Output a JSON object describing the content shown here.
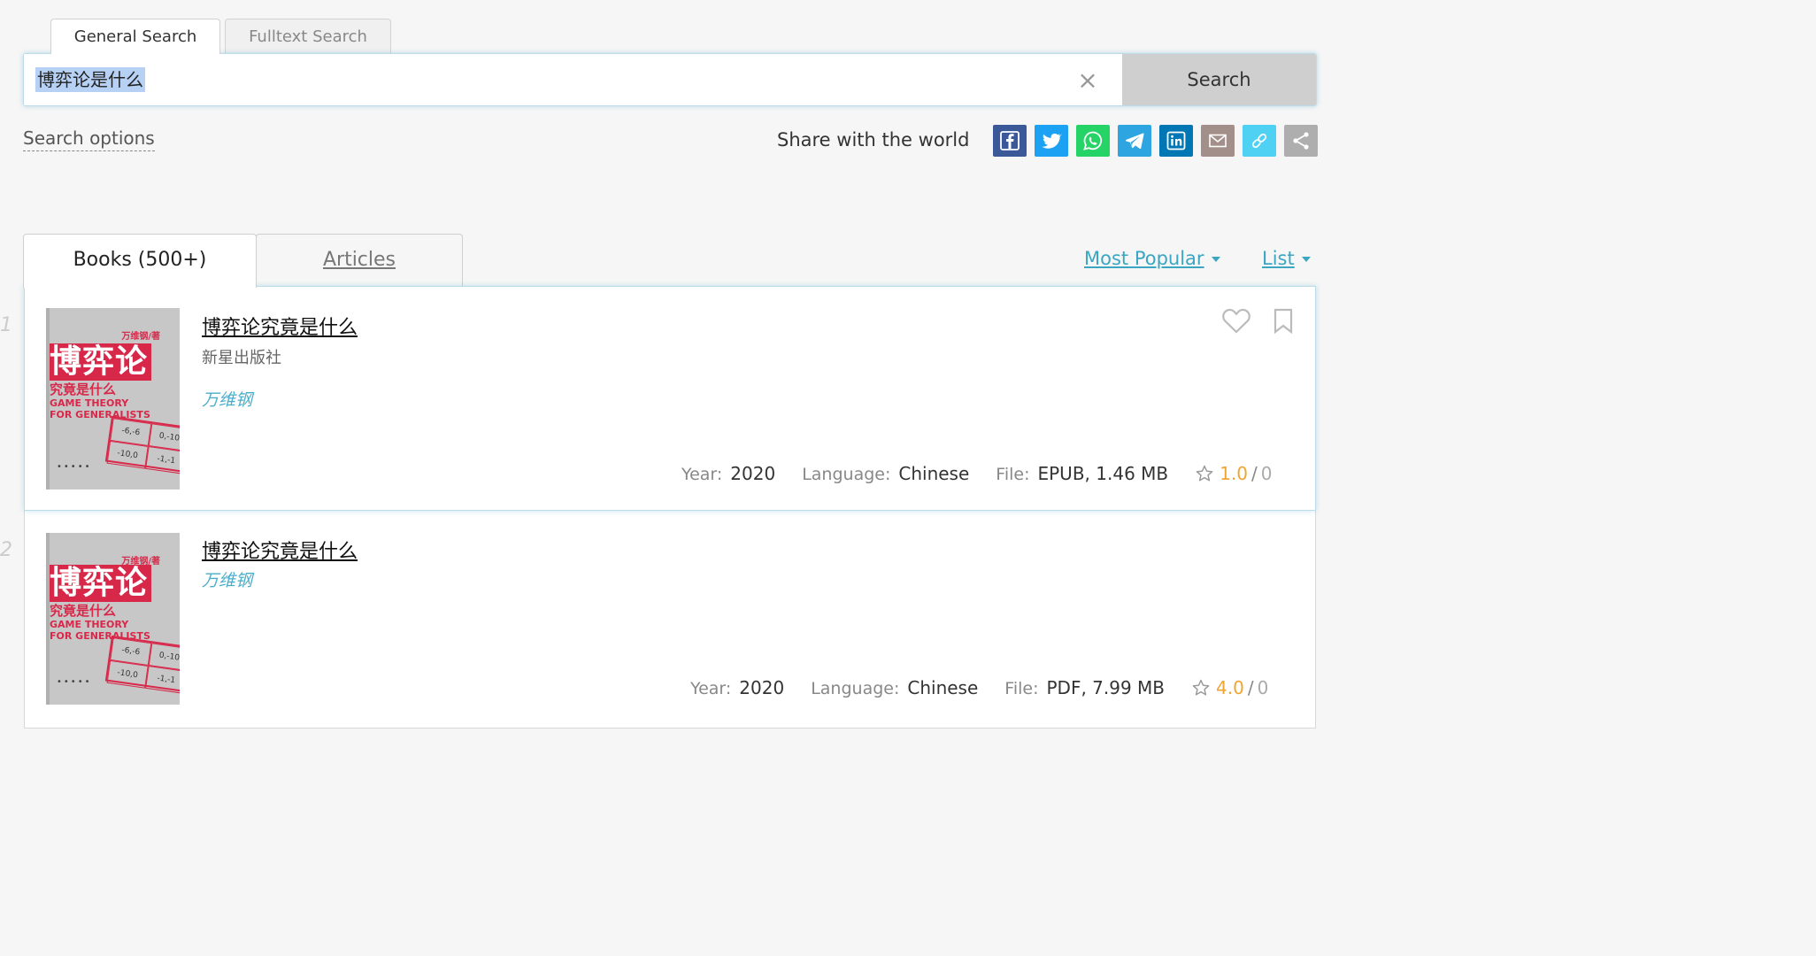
{
  "search_tabs": {
    "general": "General Search",
    "fulltext": "Fulltext Search"
  },
  "search": {
    "query": "博弈论是什么",
    "clear_icon": "close-icon",
    "button_label": "Search"
  },
  "options_link": "Search options",
  "share": {
    "label": "Share with the world",
    "icons": [
      {
        "name": "facebook-icon",
        "color": "#3b5998"
      },
      {
        "name": "twitter-icon",
        "color": "#1da1f2"
      },
      {
        "name": "whatsapp-icon",
        "color": "#25d366"
      },
      {
        "name": "telegram-icon",
        "color": "#2ca5e0"
      },
      {
        "name": "linkedin-icon",
        "color": "#0077b5"
      },
      {
        "name": "email-icon",
        "color": "#a38f8a"
      },
      {
        "name": "link-icon",
        "color": "#4fd1f4"
      },
      {
        "name": "share-icon",
        "color": "#aeaeae"
      }
    ]
  },
  "result_tabs": {
    "books": "Books (500+)",
    "articles": "Articles"
  },
  "sort": {
    "order": "Most Popular",
    "view": "List"
  },
  "results": [
    {
      "index": "1",
      "title": "博弈论究竟是什么",
      "publisher": "新星出版社",
      "author": "万维钢",
      "year_label": "Year:",
      "year": "2020",
      "language_label": "Language:",
      "language": "Chinese",
      "file_label": "File:",
      "file": "EPUB, 1.46 MB",
      "rating": "1.0",
      "votes": "0",
      "cover": {
        "author": "万维钢/著",
        "title": "博弈论",
        "subtitle": "究竟是什么",
        "english": "GAME THEORY\nFOR GENERALISTS",
        "matrix": [
          "-6,-6",
          "0,-10",
          "-10,0",
          "-1,-1"
        ]
      }
    },
    {
      "index": "2",
      "title": "博弈论究竟是什么",
      "publisher": "",
      "author": "万维钢",
      "year_label": "Year:",
      "year": "2020",
      "language_label": "Language:",
      "language": "Chinese",
      "file_label": "File:",
      "file": "PDF, 7.99 MB",
      "rating": "4.0",
      "votes": "0",
      "cover": {
        "author": "万维钢/著",
        "title": "博弈论",
        "subtitle": "究竟是什么",
        "english": "GAME THEORY\nFOR GENERALISTS",
        "matrix": [
          "-6,-6",
          "0,-10",
          "-10,0",
          "-1,-1"
        ]
      }
    }
  ],
  "colors": {
    "accent": "#3aa6c2",
    "rating": "#f0a431"
  }
}
